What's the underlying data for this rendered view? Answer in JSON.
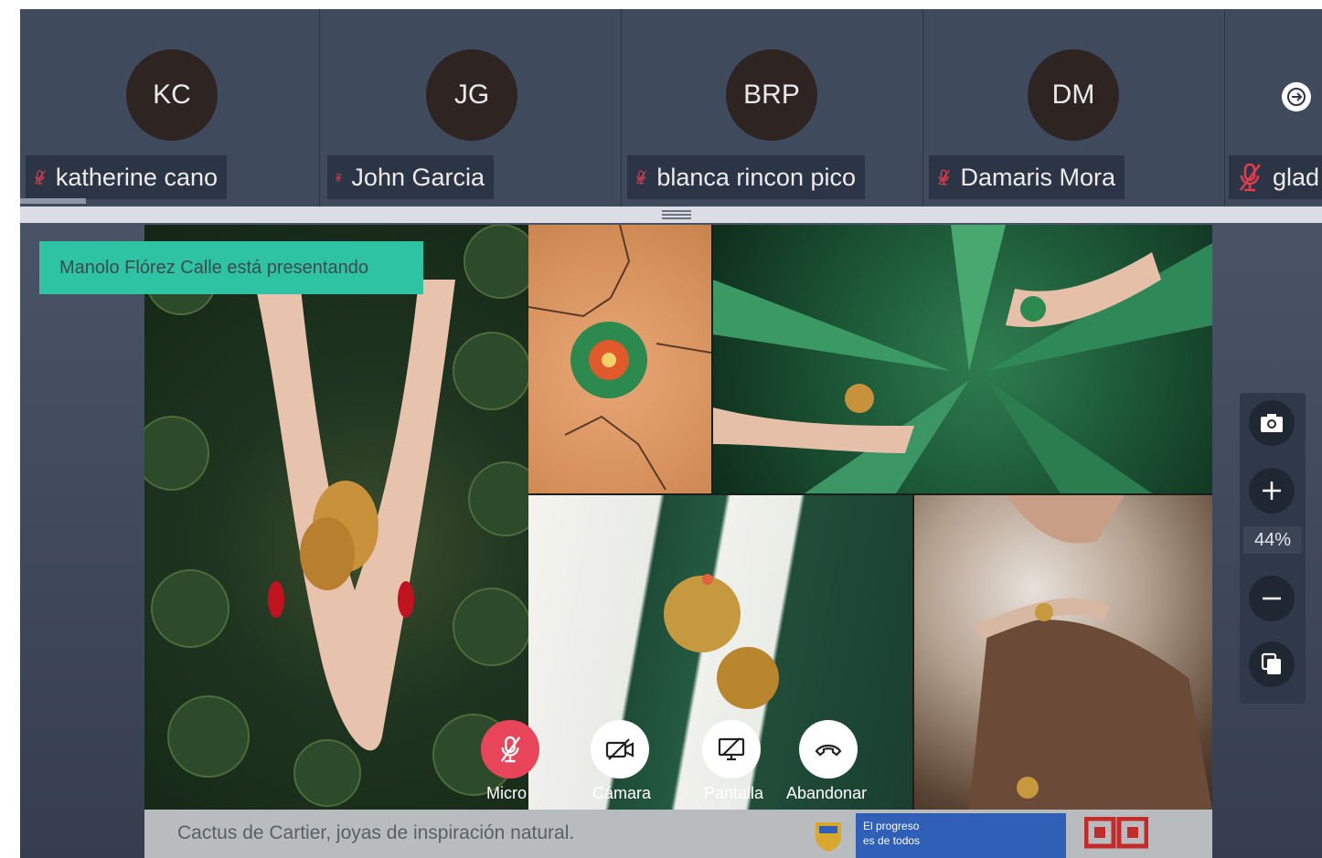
{
  "participants": [
    {
      "initials": "KC",
      "name": "katherine cano"
    },
    {
      "initials": "JG",
      "name": "John Garcia"
    },
    {
      "initials": "BRP",
      "name": "blanca rincon pico"
    },
    {
      "initials": "DM",
      "name": "Damaris Mora"
    },
    {
      "initials": "",
      "name": "glad"
    }
  ],
  "presenter_banner": "Manolo Flórez Calle está presentando",
  "slide": {
    "caption": "Cactus de Cartier, joyas de inspiración natural.",
    "logo_text_1": "El progreso",
    "logo_text_2": "es de todos"
  },
  "zoom": {
    "level": "44%"
  },
  "controls": {
    "micro": "Micro",
    "camara": "Cámara",
    "pantalla": "Pantalla",
    "abandonar": "Abandonar"
  },
  "colors": {
    "banner": "#2ec4a3",
    "mute_red": "#e8455a",
    "background": "#3a4558"
  },
  "icons": [
    "mic-off-icon",
    "arrow-right-icon",
    "camera-snapshot-icon",
    "zoom-in-icon",
    "zoom-out-icon",
    "copy-icon",
    "camera-off-icon",
    "screen-share-off-icon",
    "hang-up-icon"
  ]
}
